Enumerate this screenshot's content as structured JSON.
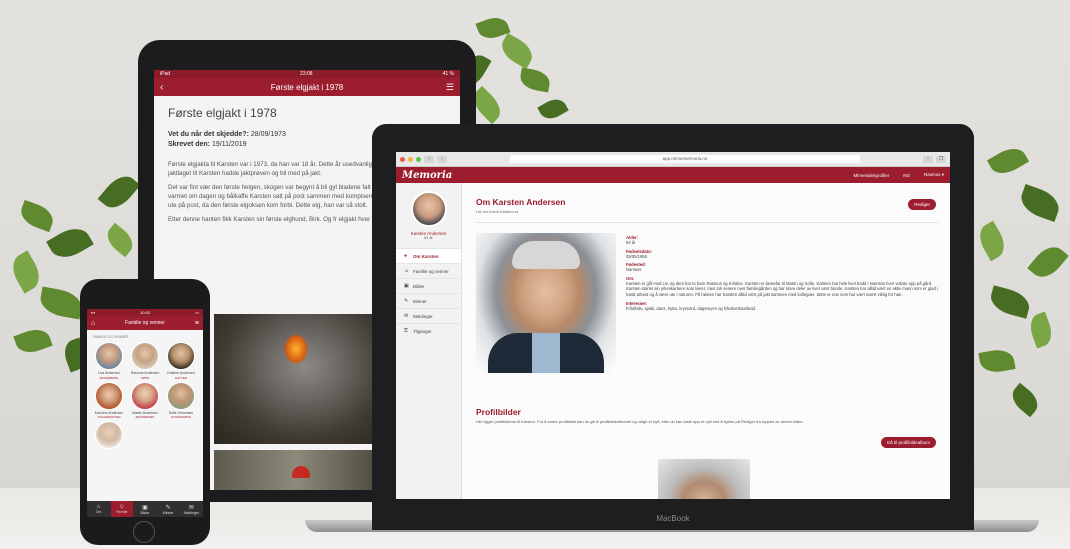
{
  "tablet": {
    "status_left": "iPad",
    "status_time": "23:08",
    "status_right": "41 %",
    "nav_title": "Første elgjakt i 1978",
    "title": "Første elgjakt i 1978",
    "meta_happened_label": "Vet du når det skjedde?:",
    "meta_happened_value": "28/09/1973",
    "meta_written_label": "Skrevet den:",
    "meta_written_value": "19/11/2019",
    "paragraphs": [
      "Første elgjakta til Karsten var i 1973, da han var 18 år. Dette år usedvanlig mye elg i Trøndelag, og jaktlaget til Karsten hadde jaktprøven og bil med på jakt.",
      "Det var fint vær den første helgen, skogen var begynt å bli gyl bladene falt med fra treet. Solen varmet om dagen og bålkaffe Karsten satt på post sammen med kompisen Olaf. 15 tiden m Karsten ute på post, da den første elgoksen kom forbi. Dette elg, han var så stolt.",
      "Etter denne hanten fikk Karsten sin første elghund, Birk. Og fr elgjakt hver høst fram til han ble 75år."
    ]
  },
  "phone": {
    "status_time": "10:02",
    "nav_title": "Familie og venner",
    "section_label": "FAMILIE OG VENNER",
    "people": [
      {
        "name": "Liva Andersen",
        "relation": "BARNEBARN",
        "color": "#6a88a4"
      },
      {
        "name": "Rasmus Andersen",
        "relation": "SØNN",
        "color": "#d8cbb8"
      },
      {
        "name": "Kristine Andersen",
        "relation": "DATTER",
        "color": "#a98a6e"
      },
      {
        "name": "Karoline Andersen",
        "relation": "SVIGERDATTER",
        "color": "#b5562d"
      },
      {
        "name": "Martin Andersen",
        "relation": "BARNEBARN",
        "color": "#c44a50"
      },
      {
        "name": "Sofie Simonsen",
        "relation": "SVIGERSØNN",
        "color": "#8e9c7c"
      },
      {
        "name": "",
        "relation": "",
        "color": "#d1b9a3"
      }
    ],
    "tabs": [
      {
        "label": "Om",
        "icon": "⌂"
      },
      {
        "label": "Familie",
        "icon": "☺"
      },
      {
        "label": "Bilder",
        "icon": "▣"
      },
      {
        "label": "Minner",
        "icon": "✎"
      },
      {
        "label": "Meldinger",
        "icon": "✉"
      }
    ]
  },
  "laptop": {
    "brand_label": "MacBook",
    "url": "app.minnememoria.no",
    "brand": "Memoria",
    "header_links": [
      "Minnesiderprofiler",
      "NO",
      "Rasmus ▾"
    ],
    "sidebar": {
      "name": "Karsten Andersen",
      "age": "64 år",
      "items": [
        {
          "label": "Om Karsten",
          "icon": "●"
        },
        {
          "label": "Familie og venner",
          "icon": "☺"
        },
        {
          "label": "Bilder",
          "icon": "▣"
        },
        {
          "label": "Minner",
          "icon": "✎"
        },
        {
          "label": "Meldinger",
          "icon": "✉"
        },
        {
          "label": "Tilganger",
          "icon": "⚿"
        }
      ]
    },
    "main": {
      "title": "Om Karsten Andersen",
      "subtitle": "Litt om hvem Karsten er.",
      "edit_button": "Rediger",
      "fields": [
        {
          "label": "Alder:",
          "value": "64 år"
        },
        {
          "label": "Fødselsdato:",
          "value": "05/05/1955"
        },
        {
          "label": "Fødested:",
          "value": "Namsos"
        },
        {
          "label": "Om:",
          "value": "Karsten er gift med Liv, og dem har to barn Rasmus og Kristine. Karsten er bestefar til Martin og Sofie. Karsten har hele livet bodd i Namsos hvor vokste opp på gård. Karsten startet sin yrkeskarriere som lærer, men tok senere over familiegården og har store deler av livet vært bonde. Karsten har alltid vært en aktiv mann som er glad i hardt arbeid og å være ute i naturen. På høsten har Karsten alltid vært på jakt sammen med kollegaer, dette er noe som har vært svært viktig for han."
        },
        {
          "label": "Interesser:",
          "value": "Friluftsliv, sjakk, dans, hytta, kryssord, dagsreyen og håndverksarbeid."
        }
      ],
      "profile_title": "Profilbilder",
      "profile_text": "Her ligger profilbildene til Karsten. For å endre profilbilde kan du gå til profilbildealbumet og velge et nytt, eller du kan laste opp et nytt ved å trykke på Rediger fra toppen av denne siden.",
      "profile_button": "Gå til profilbildealbum"
    }
  }
}
